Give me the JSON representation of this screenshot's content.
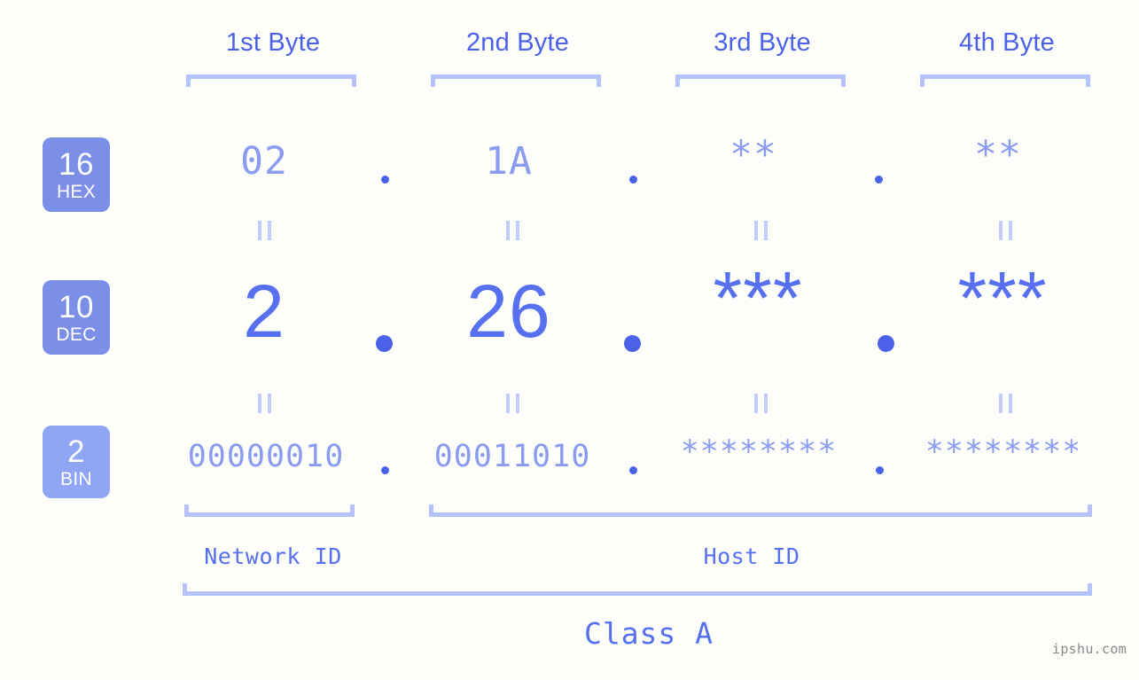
{
  "meta": {
    "background_color": "#fdfdfa",
    "accent_strong": "#4b62e8",
    "accent_medium": "#5670ef",
    "accent_light": "#8a9bf0",
    "bracket_color": "#b6c2fc",
    "badge_color": "#7b8fe8",
    "badge_color_light": "#8fa6f5",
    "watermark_color": "#8a8a8a"
  },
  "headers": {
    "byte_labels": [
      {
        "label": "1st Byte"
      },
      {
        "label": "2nd Byte"
      },
      {
        "label": "3rd Byte"
      },
      {
        "label": "4th Byte"
      }
    ]
  },
  "bases": [
    {
      "num": "16",
      "name": "HEX"
    },
    {
      "num": "10",
      "name": "DEC"
    },
    {
      "num": "2",
      "name": "BIN"
    }
  ],
  "rows": {
    "hex": {
      "base_num": "16",
      "base_name": "HEX",
      "values": [
        "02",
        "1A",
        "**",
        "**"
      ]
    },
    "dec": {
      "base_num": "10",
      "base_name": "DEC",
      "values": [
        "2",
        "26",
        "***",
        "***"
      ]
    },
    "bin": {
      "base_num": "2",
      "base_name": "BIN",
      "values": [
        "00000010",
        "00011010",
        "********",
        "********"
      ]
    }
  },
  "separators": {
    "dot": "."
  },
  "equals_marks": {
    "symbol": "=",
    "count_per_row_gap": 4
  },
  "footer": {
    "network_id_label": "Network ID",
    "host_id_label": "Host ID",
    "class_label": "Class A",
    "watermark": "ipshu.com"
  }
}
